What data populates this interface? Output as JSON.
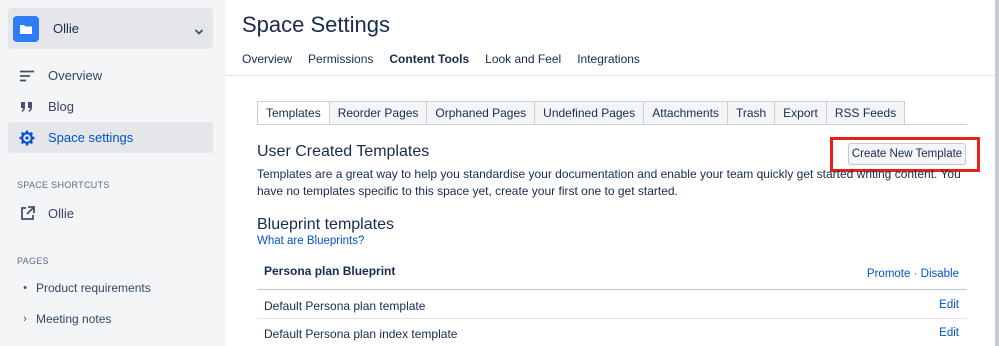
{
  "sidebar": {
    "space_name": "Ollie",
    "nav": [
      {
        "label": "Overview"
      },
      {
        "label": "Blog"
      },
      {
        "label": "Space settings"
      }
    ],
    "shortcuts_heading": "SPACE SHORTCUTS",
    "shortcut_label": "Ollie",
    "pages_heading": "PAGES",
    "pages": [
      {
        "label": "Product requirements",
        "marker": "•"
      },
      {
        "label": "Meeting notes",
        "marker": "›"
      }
    ]
  },
  "main": {
    "title": "Space Settings",
    "tabs": [
      "Overview",
      "Permissions",
      "Content Tools",
      "Look and Feel",
      "Integrations"
    ],
    "sub_tabs": [
      "Templates",
      "Reorder Pages",
      "Orphaned Pages",
      "Undefined Pages",
      "Attachments",
      "Trash",
      "Export",
      "RSS Feeds"
    ],
    "user_templates": {
      "heading": "User Created Templates",
      "create_button": "Create New Template",
      "description": "Templates are a great way to help you standardise your documentation and enable your team quickly get started writing content. You have no templates specific to this space yet, create your first one to get started."
    },
    "blueprints": {
      "heading": "Blueprint templates",
      "link": "What are Blueprints?",
      "group_title": "Persona plan Blueprint",
      "promote": "Promote",
      "separator": "·",
      "disable": "Disable",
      "rows": [
        {
          "name": "Default Persona plan template",
          "action": "Edit"
        },
        {
          "name": "Default Persona plan index template",
          "action": "Edit"
        }
      ]
    }
  },
  "colors": {
    "accent": "#0052cc",
    "space_avatar": "#2f7df6",
    "highlight": "#e62117",
    "sidebar_bg": "#f4f5f7"
  },
  "icons": {
    "space_avatar": "folder-icon",
    "switcher": "chevron-down-icon",
    "overview": "lines-icon",
    "blog": "quote-icon",
    "settings": "gear-icon",
    "shortcut": "external-link-icon"
  }
}
